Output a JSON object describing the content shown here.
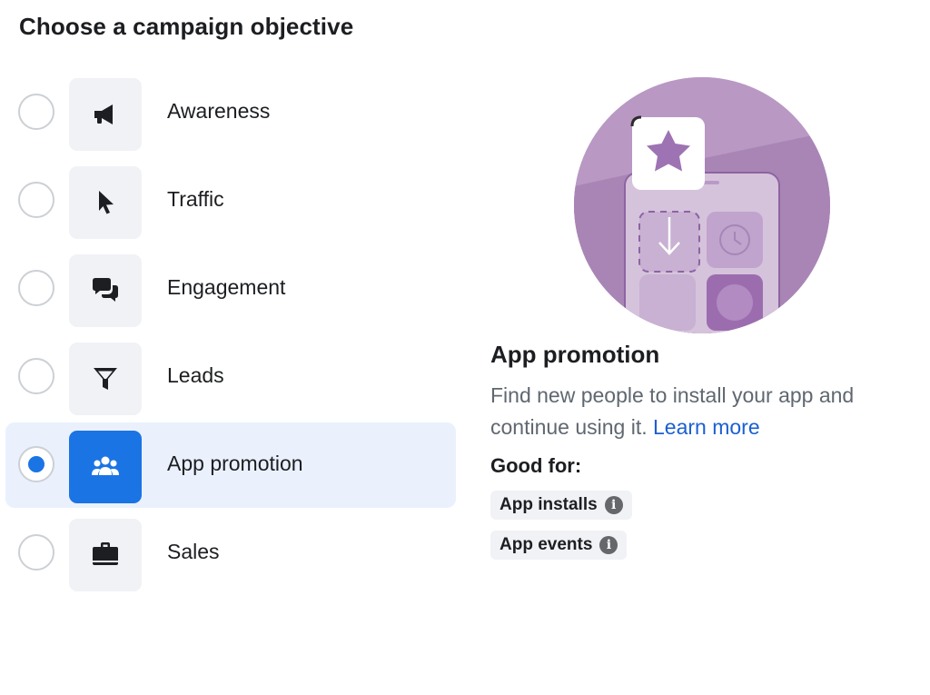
{
  "page": {
    "title": "Choose a campaign objective"
  },
  "options": [
    {
      "label": "Awareness",
      "icon": "megaphone-icon",
      "selected": false
    },
    {
      "label": "Traffic",
      "icon": "cursor-icon",
      "selected": false
    },
    {
      "label": "Engagement",
      "icon": "chat-bubbles-icon",
      "selected": false
    },
    {
      "label": "Leads",
      "icon": "funnel-icon",
      "selected": false
    },
    {
      "label": "App promotion",
      "icon": "people-icon",
      "selected": true
    },
    {
      "label": "Sales",
      "icon": "briefcase-icon",
      "selected": false
    }
  ],
  "detail": {
    "title": "App promotion",
    "description": "Find new people to install your app and continue using it.",
    "learn_more": "Learn more",
    "good_for_label": "Good for:",
    "chips": [
      {
        "label": "App installs",
        "info": "i"
      },
      {
        "label": "App events",
        "info": "i"
      }
    ]
  },
  "colors": {
    "accent": "#1b74e4",
    "selected_bg": "#eaf1fd",
    "tile_bg": "#f0f2f5",
    "link": "#1b5fd1",
    "illustration": "#b998c4"
  }
}
